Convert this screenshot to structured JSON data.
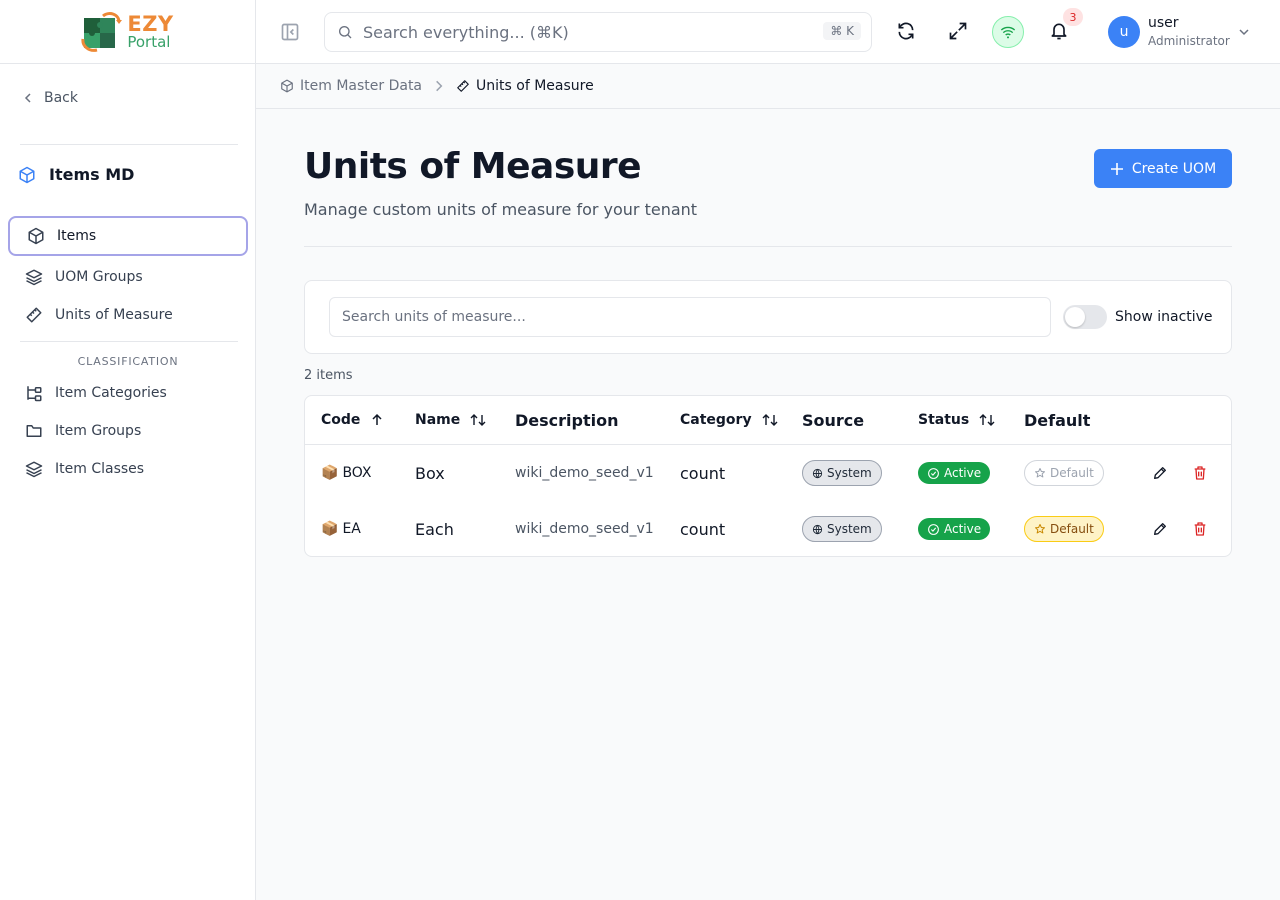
{
  "brand": {
    "name_top": "EZY",
    "name_bottom": "Portal"
  },
  "sidebar": {
    "back_label": "Back",
    "module_title": "Items MD",
    "items": [
      {
        "label": "Items",
        "icon": "package-icon",
        "active": true
      },
      {
        "label": "UOM Groups",
        "icon": "layers-icon"
      },
      {
        "label": "Units of Measure",
        "icon": "ruler-icon"
      }
    ],
    "section_label": "CLASSIFICATION",
    "classification_items": [
      {
        "label": "Item Categories",
        "icon": "tree-icon"
      },
      {
        "label": "Item Groups",
        "icon": "folder-icon"
      },
      {
        "label": "Item Classes",
        "icon": "layers-icon"
      }
    ]
  },
  "topbar": {
    "search_placeholder": "Search everything... (⌘K)",
    "search_shortcut": "⌘ K",
    "notification_count": "3",
    "user_initial": "u",
    "user_name": "user",
    "user_role": "Administrator"
  },
  "breadcrumb": {
    "parent": "Item Master Data",
    "current": "Units of Measure"
  },
  "page": {
    "title": "Units of Measure",
    "subtitle": "Manage custom units of measure for your tenant",
    "create_label": "Create UOM"
  },
  "filter": {
    "search_placeholder": "Search units of measure...",
    "toggle_label": "Show inactive",
    "toggle_on": false
  },
  "item_count": "2 items",
  "table": {
    "headers": {
      "code": "Code",
      "name": "Name",
      "description": "Description",
      "category": "Category",
      "source": "Source",
      "status": "Status",
      "default": "Default"
    },
    "rows": [
      {
        "code_emoji": "📦",
        "code": "BOX",
        "name": "Box",
        "description": "wiki_demo_seed_v1",
        "category": "count",
        "source": "System",
        "status": "Active",
        "default": "Default",
        "is_default": false
      },
      {
        "code_emoji": "📦",
        "code": "EA",
        "name": "Each",
        "description": "wiki_demo_seed_v1",
        "category": "count",
        "source": "System",
        "status": "Active",
        "default": "Default",
        "is_default": true
      }
    ]
  },
  "colors": {
    "accent": "#3b82f6",
    "active_green": "#16a34a",
    "delete_red": "#dc2626",
    "default_yellow": "#fef3c7"
  }
}
